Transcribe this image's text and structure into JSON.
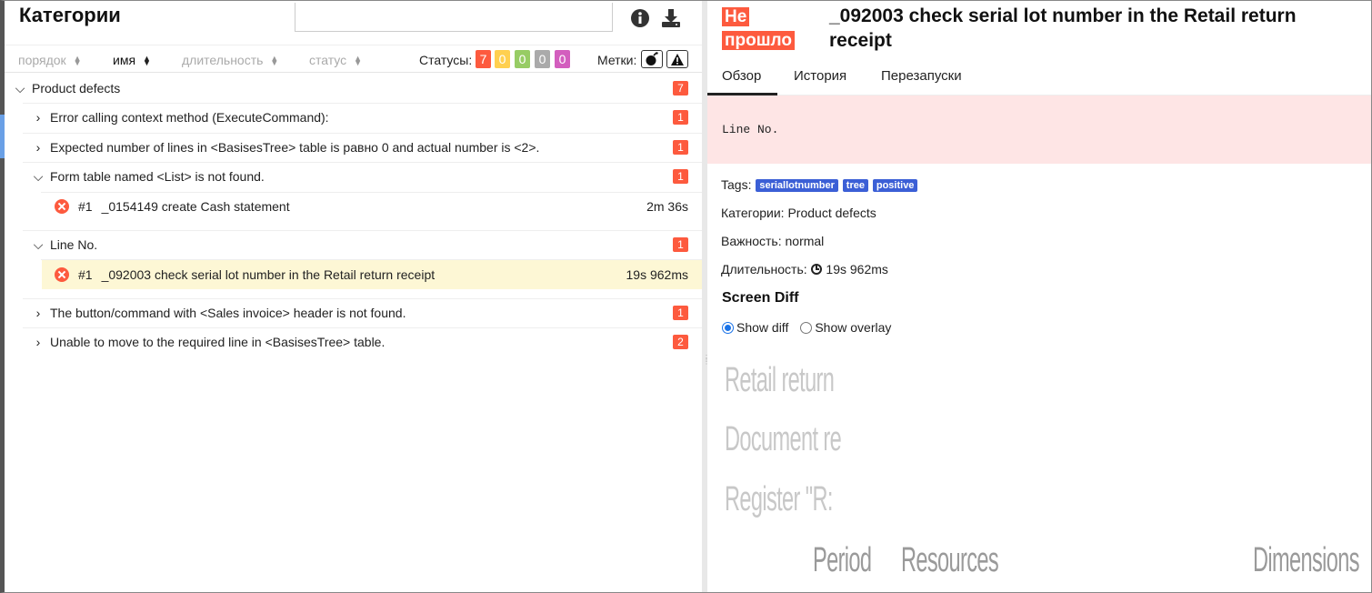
{
  "left": {
    "title": "Категории",
    "search": {
      "value": "",
      "placeholder": ""
    },
    "sort": {
      "order": "порядок",
      "name": "имя",
      "duration": "длительность",
      "status": "статус"
    },
    "statuses_label": "Статусы:",
    "status_counts": [
      {
        "value": "7",
        "color": "#fd5a3e"
      },
      {
        "value": "0",
        "color": "#ffd050"
      },
      {
        "value": "0",
        "color": "#97cc64"
      },
      {
        "value": "0",
        "color": "#aaaaaa"
      },
      {
        "value": "0",
        "color": "#d35ebe"
      }
    ],
    "marks_label": "Метки:",
    "tree": {
      "root": {
        "label": "Product defects",
        "count": "7"
      },
      "groups": [
        {
          "label": "Error calling context method (ExecuteCommand):",
          "count": "1"
        },
        {
          "label": "Expected number of lines in <BasisesTree> table is равно 0 and actual number is <2>.",
          "count": "1"
        },
        {
          "label": "Form table named <List> is not found.",
          "count": "1",
          "test": {
            "num": "#1",
            "name": "_0154149 create Cash statement",
            "duration": "2m 36s"
          }
        },
        {
          "label": "Line No.",
          "count": "1",
          "test": {
            "num": "#1",
            "name": "_092003 check serial lot number in the Retail return receipt",
            "duration": "19s 962ms"
          }
        },
        {
          "label": "The button/command with <Sales invoice> header is not found.",
          "count": "1"
        },
        {
          "label": "Unable to move to the required line in <BasisesTree> table.",
          "count": "2"
        }
      ]
    }
  },
  "right": {
    "status": "Не прошло",
    "title": "_092003 check serial lot number in the Retail return receipt",
    "tabs": [
      "Обзор",
      "История",
      "Перезапуски"
    ],
    "error_message": "Line No.",
    "tags_label": "Tags:",
    "tags": [
      "seriallotnumber",
      "tree",
      "positive"
    ],
    "category_line": "Категории: Product defects",
    "severity_line": "Важность: normal",
    "duration_label": "Длительность:",
    "duration_value": "19s 962ms",
    "screen_diff_title": "Screen Diff",
    "show_diff": "Show diff",
    "show_overlay": "Show overlay",
    "diff_image_text": {
      "line1": "Retail return",
      "line2": "Document re",
      "line3": "Register \"R:",
      "col1": "Period",
      "col2": "Resources",
      "col3": "Dimensions"
    }
  },
  "colors": {
    "failed": "#fd5a3e",
    "tag": "#3b5fd6",
    "error_bg": "#fee5e5",
    "selected_row": "#fdf7d5"
  }
}
